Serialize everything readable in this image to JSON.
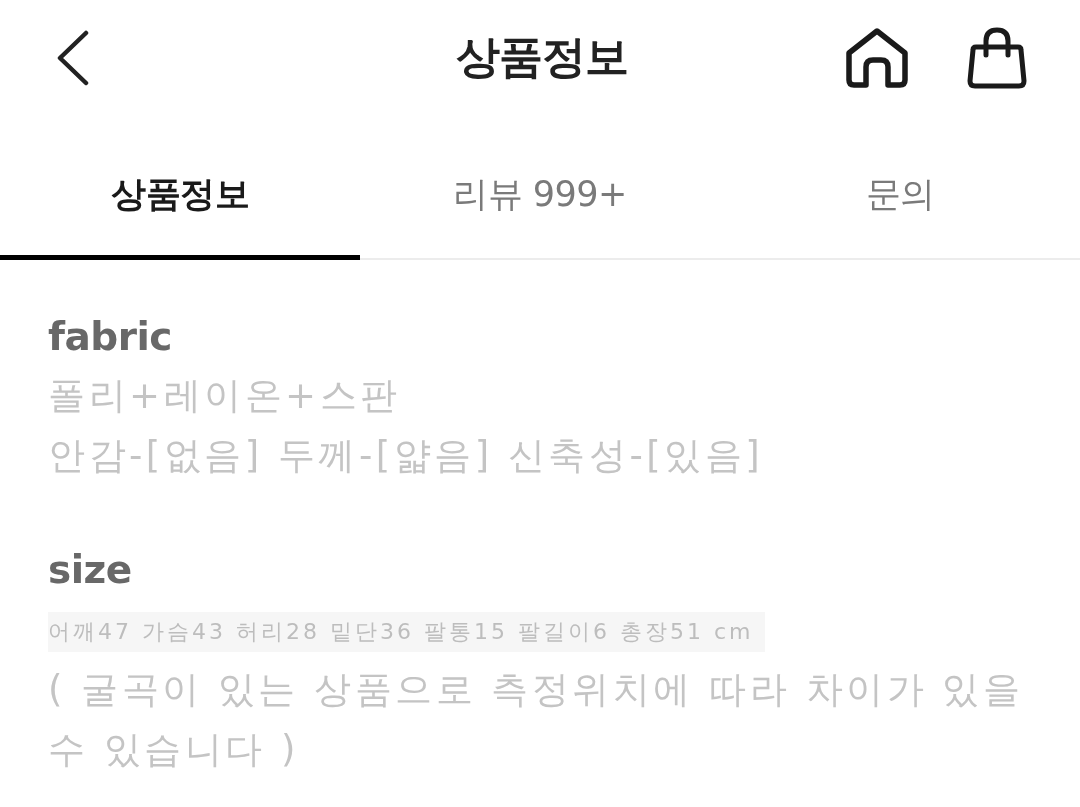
{
  "header": {
    "title": "상품정보"
  },
  "tabs": [
    {
      "label": "상품정보",
      "selected": true
    },
    {
      "label": "리뷰 999+",
      "selected": false
    },
    {
      "label": "문의",
      "selected": false
    }
  ],
  "sections": [
    {
      "heading": "fabric",
      "lines": [
        {
          "kind": "text",
          "text": "폴리+레이온+스판"
        },
        {
          "kind": "text",
          "text": "안감-[없음] 두께-[얇음] 신축성-[있음]"
        }
      ]
    },
    {
      "heading": "size",
      "lines": [
        {
          "kind": "measure",
          "text": "어깨47 가슴43 허리28 밑단36 팔통15 팔길이6 총장51 cm"
        },
        {
          "kind": "text",
          "text": "( 굴곡이 있는 상품으로 측정위치에 따라 차이가 있을 수 있습니다 )"
        }
      ]
    }
  ]
}
